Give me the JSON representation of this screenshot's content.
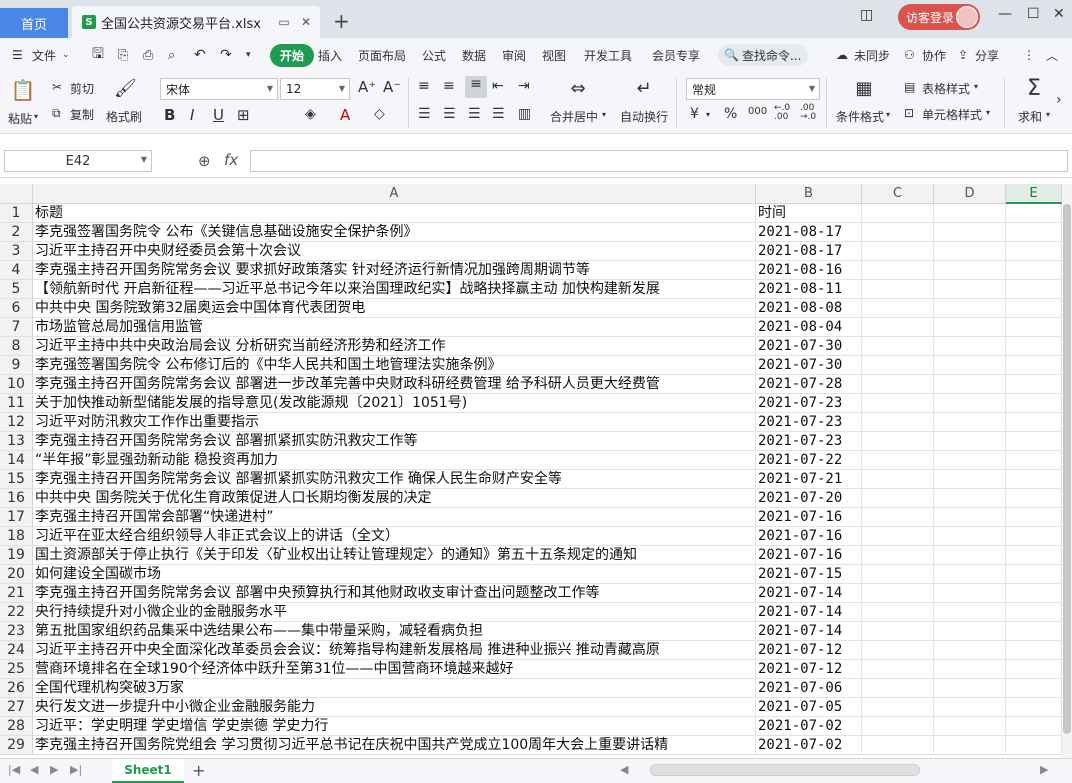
{
  "tabbar": {
    "home": "首页",
    "file_title": "全国公共资源交易平台.xlsx",
    "login": "访客登录"
  },
  "menu": {
    "file": "文件",
    "start": "开始",
    "items": [
      "插入",
      "页面布局",
      "公式",
      "数据",
      "审阅",
      "视图",
      "开发工具",
      "会员专享"
    ],
    "search": "查找命令...",
    "sync": "未同步",
    "collab": "协作",
    "share": "分享"
  },
  "ribbon": {
    "paste": "粘贴",
    "cut": "剪切",
    "copy": "复制",
    "format_painter": "格式刷",
    "font": "宋体",
    "font_size": "12",
    "merge": "合并居中",
    "wrap": "自动换行",
    "number_format": "常规",
    "cond_format": "条件格式",
    "table_style": "表格样式",
    "cell_style": "单元格样式",
    "sum": "求和"
  },
  "formula_bar": {
    "name_box": "E42",
    "fx": "fx"
  },
  "grid": {
    "columns": [
      "A",
      "B",
      "C",
      "D",
      "E"
    ],
    "rows": [
      [
        "1",
        "标题",
        "时间"
      ],
      [
        "2",
        "李克强签署国务院令 公布《关键信息基础设施安全保护条例》",
        "2021-08-17"
      ],
      [
        "3",
        "习近平主持召开中央财经委员会第十次会议",
        "2021-08-17"
      ],
      [
        "4",
        "李克强主持召开国务院常务会议 要求抓好政策落实 针对经济运行新情况加强跨周期调节等",
        "2021-08-16"
      ],
      [
        "5",
        "【领航新时代 开启新征程——习近平总书记今年以来治国理政纪实】战略抉择赢主动 加快构建新发展",
        "2021-08-11"
      ],
      [
        "6",
        "中共中央 国务院致第32届奥运会中国体育代表团贺电",
        "2021-08-08"
      ],
      [
        "7",
        "市场监管总局加强信用监管",
        "2021-08-04"
      ],
      [
        "8",
        "习近平主持中共中央政治局会议 分析研究当前经济形势和经济工作",
        "2021-07-30"
      ],
      [
        "9",
        "李克强签署国务院令 公布修订后的《中华人民共和国土地管理法实施条例》",
        "2021-07-30"
      ],
      [
        "10",
        "李克强主持召开国务院常务会议 部署进一步改革完善中央财政科研经费管理 给予科研人员更大经费管",
        "2021-07-28"
      ],
      [
        "11",
        "关于加快推动新型储能发展的指导意见(发改能源规〔2021〕1051号)",
        "2021-07-23"
      ],
      [
        "12",
        "习近平对防汛救灾工作作出重要指示",
        "2021-07-23"
      ],
      [
        "13",
        "李克强主持召开国务院常务会议 部署抓紧抓实防汛救灾工作等",
        "2021-07-23"
      ],
      [
        "14",
        "“半年报”彰显强劲新动能 稳投资再加力",
        "2021-07-22"
      ],
      [
        "15",
        "李克强主持召开国务院常务会议 部署抓紧抓实防汛救灾工作 确保人民生命财产安全等",
        "2021-07-21"
      ],
      [
        "16",
        "中共中央 国务院关于优化生育政策促进人口长期均衡发展的决定",
        "2021-07-20"
      ],
      [
        "17",
        "李克强主持召开国常会部署“快递进村”",
        "2021-07-16"
      ],
      [
        "18",
        "习近平在亚太经合组织领导人非正式会议上的讲话（全文）",
        "2021-07-16"
      ],
      [
        "19",
        "国土资源部关于停止执行《关于印发〈矿业权出让转让管理规定〉的通知》第五十五条规定的通知",
        "2021-07-16"
      ],
      [
        "20",
        "如何建设全国碳市场",
        "2021-07-15"
      ],
      [
        "21",
        "李克强主持召开国务院常务会议 部署中央预算执行和其他财政收支审计查出问题整改工作等",
        "2021-07-14"
      ],
      [
        "22",
        "央行持续提升对小微企业的金融服务水平",
        "2021-07-14"
      ],
      [
        "23",
        "第五批国家组织药品集采中选结果公布——集中带量采购，减轻看病负担",
        "2021-07-14"
      ],
      [
        "24",
        "习近平主持召开中央全面深化改革委员会会议：统筹指导构建新发展格局 推进种业振兴 推动青藏高原",
        "2021-07-12"
      ],
      [
        "25",
        "营商环境排名在全球190个经济体中跃升至第31位——中国营商环境越来越好",
        "2021-07-12"
      ],
      [
        "26",
        "全国代理机构突破3万家",
        "2021-07-06"
      ],
      [
        "27",
        "央行发文进一步提升中小微企业金融服务能力",
        "2021-07-05"
      ],
      [
        "28",
        "习近平：学史明理 学史增信 学史崇德 学史力行",
        "2021-07-02"
      ],
      [
        "29",
        "李克强主持召开国务院党组会 学习贯彻习近平总书记在庆祝中国共产党成立100周年大会上重要讲话精",
        "2021-07-02"
      ]
    ]
  },
  "sheets": {
    "active": "Sheet1"
  }
}
